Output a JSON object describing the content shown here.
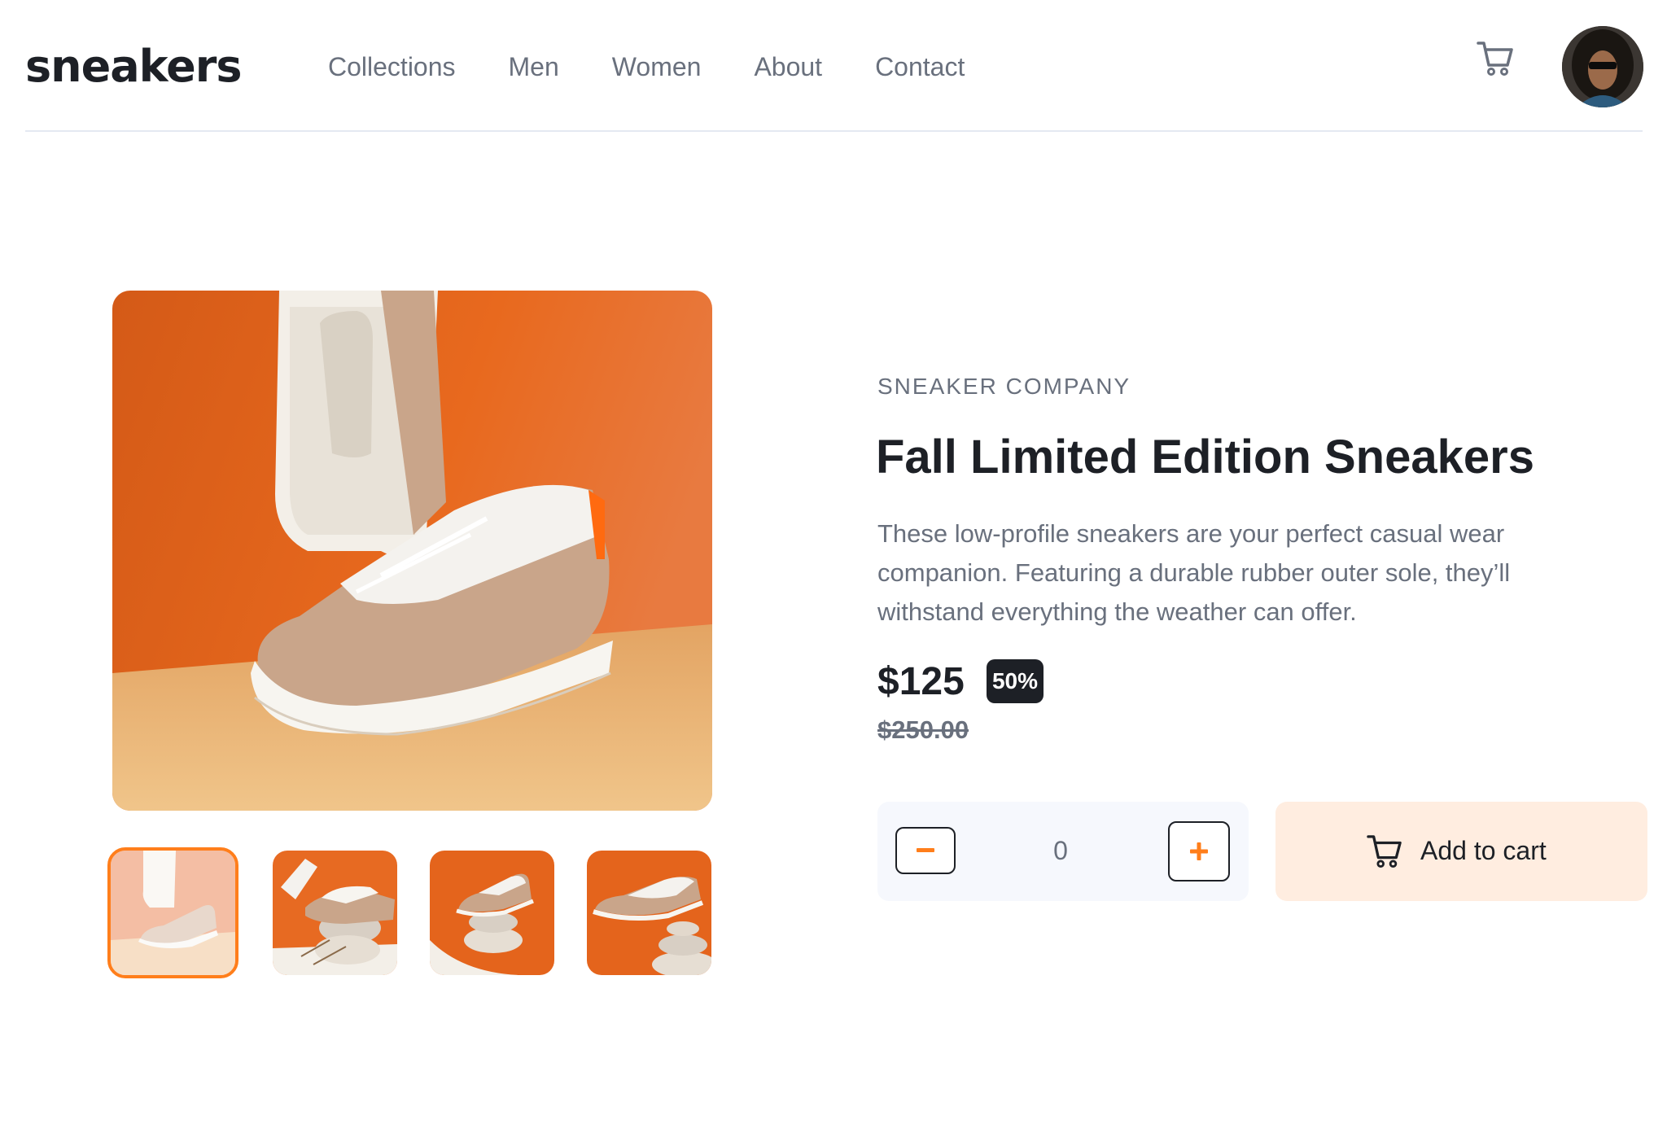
{
  "header": {
    "logo": "sneakers",
    "nav": [
      "Collections",
      "Men",
      "Women",
      "About",
      "Contact"
    ],
    "cart_icon": "cart-icon",
    "avatar_icon": "user-avatar"
  },
  "gallery": {
    "main_image": "sneaker product photo on orange background",
    "thumbnails": [
      "thumbnail 1",
      "thumbnail 2",
      "thumbnail 3",
      "thumbnail 4"
    ],
    "active_thumbnail": 1
  },
  "product": {
    "company": "SNEAKER COMPANY",
    "title": "Fall Limited Edition Sneakers",
    "description": "These low-profile sneakers are your perfect casual wear companion. Featuring a durable rubber outer sole, they’ll withstand everything the weather can offer.",
    "price": "$125",
    "discount": "50%",
    "original_price": "$250.00"
  },
  "cart_controls": {
    "quantity": "0",
    "minus_icon": "minus-icon",
    "plus_icon": "plus-icon",
    "add_to_cart_label": "Add to cart",
    "add_to_cart_icon": "cart-icon"
  },
  "colors": {
    "accent": "#ff7e1b",
    "accent_pale": "#ffede0",
    "dark": "#1d2026",
    "grey_text": "#69707d",
    "light_bg": "#f6f8fd"
  }
}
